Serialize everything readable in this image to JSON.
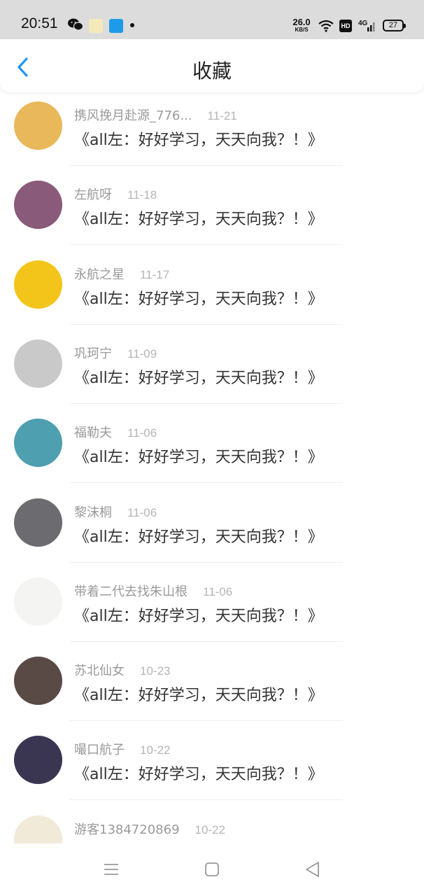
{
  "status_bar": {
    "time": "20:51",
    "net_speed_value": "26.0",
    "net_speed_unit": "KB/S",
    "hd_label": "HD",
    "network_label": "4G",
    "battery": "27"
  },
  "header": {
    "title": "收藏",
    "accent_color": "#2196f3"
  },
  "favorites": [
    {
      "author": "携风挽月赴源_776...",
      "date": "11-21",
      "title": "《all左：好好学习，天天向我？！》",
      "avatar_color": "#e9b85a"
    },
    {
      "author": "左航呀",
      "date": "11-18",
      "title": "《all左：好好学习，天天向我？！》",
      "avatar_color": "#8a5a7a"
    },
    {
      "author": "永航之星",
      "date": "11-17",
      "title": "《all左：好好学习，天天向我？！》",
      "avatar_color": "#f3c51b"
    },
    {
      "author": "巩珂宁",
      "date": "11-09",
      "title": "《all左：好好学习，天天向我？！》",
      "avatar_color": "#c9c9c9"
    },
    {
      "author": "福勒夫",
      "date": "11-06",
      "title": "《all左：好好学习，天天向我？！》",
      "avatar_color": "#4e9fb0"
    },
    {
      "author": "黎沫桐",
      "date": "11-06",
      "title": "《all左：好好学习，天天向我？！》",
      "avatar_color": "#6b6b70"
    },
    {
      "author": "带着二代去找朱山根",
      "date": "11-06",
      "title": "《all左：好好学习，天天向我？！》",
      "avatar_color": "#f4f4f2"
    },
    {
      "author": "苏北仙女",
      "date": "10-23",
      "title": "《all左：好好学习，天天向我？！》",
      "avatar_color": "#5a4a45"
    },
    {
      "author": "嘬口航子",
      "date": "10-22",
      "title": "《all左：好好学习，天天向我？！》",
      "avatar_color": "#3a3550"
    },
    {
      "author": "游客1384720869",
      "date": "10-22",
      "title": "",
      "avatar_color": "#f1ead8"
    }
  ],
  "navbar": {
    "icons": [
      "menu-icon",
      "home-square-icon",
      "back-triangle-icon"
    ]
  }
}
